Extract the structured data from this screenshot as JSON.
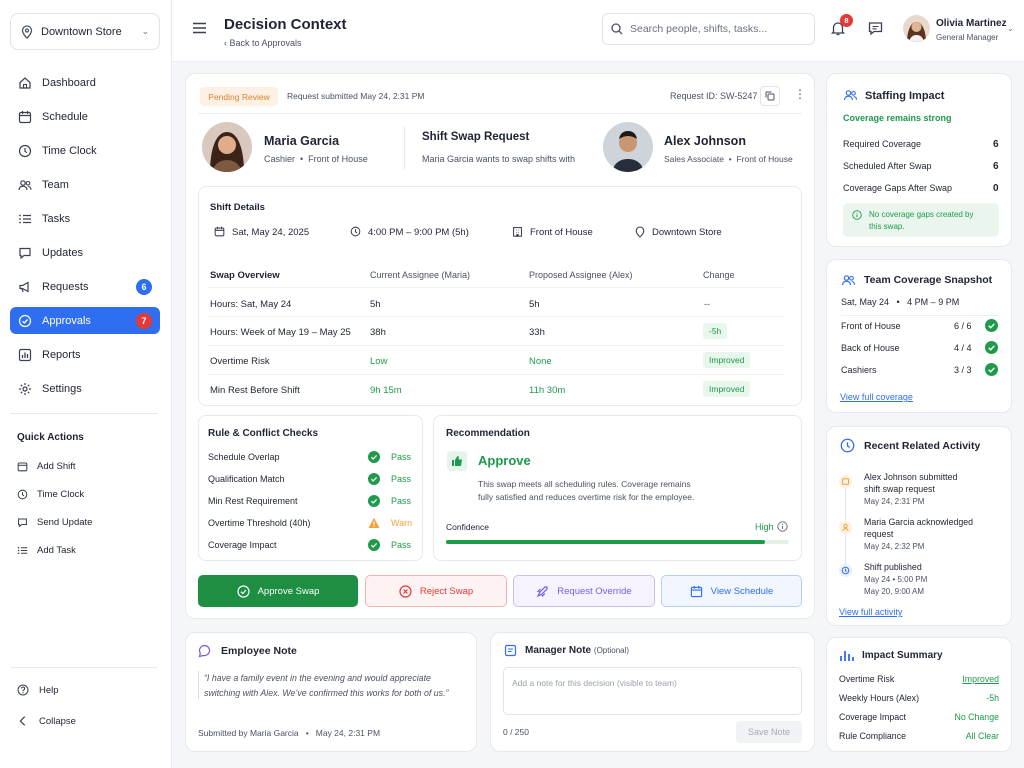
{
  "sidebar": {
    "store": "Downtown Store",
    "items": [
      {
        "label": "Dashboard",
        "icon": "home-icon"
      },
      {
        "label": "Schedule",
        "icon": "calendar-icon"
      },
      {
        "label": "Time Clock",
        "icon": "clock-icon"
      },
      {
        "label": "Team",
        "icon": "users-icon"
      },
      {
        "label": "Tasks",
        "icon": "list-icon"
      },
      {
        "label": "Updates",
        "icon": "message-icon"
      },
      {
        "label": "Requests",
        "icon": "megaphone-icon",
        "badge": "6"
      },
      {
        "label": "Approvals",
        "icon": "check-badge-icon",
        "badge": "7",
        "active": true
      },
      {
        "label": "Reports",
        "icon": "chart-icon"
      },
      {
        "label": "Settings",
        "icon": "gear-icon"
      }
    ],
    "quick_actions_title": "Quick Actions",
    "quick_actions": [
      "Add Shift",
      "Time Clock",
      "Send Update",
      "Add Task"
    ],
    "help": "Help",
    "collapse": "Collapse"
  },
  "header": {
    "title": "Decision Context",
    "back": "Back to Approvals",
    "search_placeholder": "Search people, shifts, tasks...",
    "notif_count": "8",
    "user_name": "Olivia Martinez",
    "user_role": "General Manager"
  },
  "request": {
    "status": "Pending Review",
    "submitted": "Request submitted May 24, 2:31 PM",
    "id": "Request ID: SW-5247",
    "from": {
      "name": "Maria Garcia",
      "role": "Cashier",
      "dept": "Front of House"
    },
    "type": "Shift Swap Request",
    "desc": "Maria Garcia wants to swap shifts with",
    "to": {
      "name": "Alex Johnson",
      "role": "Sales Associate",
      "dept": "Front of House"
    }
  },
  "shift": {
    "title": "Shift Details",
    "date": "Sat, May 24, 2025",
    "time": "4:00 PM – 9:00 PM (5h)",
    "area": "Front of House",
    "location": "Downtown Store"
  },
  "overview": {
    "headers": [
      "Swap Overview",
      "Current Assignee (Maria)",
      "Proposed Assignee (Alex)",
      "Change"
    ],
    "rows": [
      {
        "label": "Hours: Sat, May 24",
        "current": "5h",
        "proposed": "5h",
        "change": "--",
        "tag": false
      },
      {
        "label": "Hours: Week of May 19 – May 25",
        "current": "38h",
        "proposed": "33h",
        "change": "-5h",
        "tag": true
      },
      {
        "label": "Overtime Risk",
        "current": "Low",
        "proposed": "None",
        "change": "Improved",
        "tag": true,
        "green": true
      },
      {
        "label": "Min Rest Before Shift",
        "current": "9h 15m",
        "proposed": "11h 30m",
        "change": "Improved",
        "tag": true,
        "green": true
      }
    ]
  },
  "checks": {
    "title": "Rule & Conflict Checks",
    "items": [
      {
        "label": "Schedule Overlap",
        "status": "Pass"
      },
      {
        "label": "Qualification Match",
        "status": "Pass"
      },
      {
        "label": "Min Rest Requirement",
        "status": "Pass"
      },
      {
        "label": "Overtime Threshold (40h)",
        "status": "Warn"
      },
      {
        "label": "Coverage Impact",
        "status": "Pass"
      }
    ]
  },
  "recommendation": {
    "title": "Recommendation",
    "verdict": "Approve",
    "text1": "This swap meets all scheduling rules. Coverage remains",
    "text2": "fully satisfied and reduces overtime risk for the employee.",
    "confidence_label": "Confidence",
    "confidence_value": "High",
    "confidence_fraction": 0.93
  },
  "actions": {
    "approve": "Approve Swap",
    "reject": "Reject Swap",
    "override": "Request Override",
    "schedule": "View Schedule"
  },
  "employee_note": {
    "title": "Employee Note",
    "text1": "“I have a family event in the evening and would appreciate",
    "text2": "switching with Alex. We’ve confirmed this works for both of us.”",
    "footer": "Submitted by Maria Garcia   •   May 24, 2:31 PM"
  },
  "manager_note": {
    "title": "Manager Note",
    "optional": "(Optional)",
    "placeholder": "Add a note for this decision (visible to team)",
    "count": "0 / 250",
    "save": "Save Note"
  },
  "staffing": {
    "title": "Staffing Impact",
    "status": "Coverage remains strong",
    "rows": [
      {
        "label": "Required Coverage",
        "value": "6"
      },
      {
        "label": "Scheduled After Swap",
        "value": "6"
      },
      {
        "label": "Coverage Gaps After Swap",
        "value": "0"
      }
    ],
    "note1": "No coverage gaps created by",
    "note2": "this swap."
  },
  "snapshot": {
    "title": "Team Coverage Snapshot",
    "subtitle": "Sat, May 24   •   4 PM – 9 PM",
    "rows": [
      {
        "label": "Front of House",
        "value": "6 / 6"
      },
      {
        "label": "Back of House",
        "value": "4 / 4"
      },
      {
        "label": "Cashiers",
        "value": "3 / 3"
      }
    ],
    "link": "View full coverage"
  },
  "activity": {
    "title": "Recent Related Activity",
    "items": [
      {
        "line1": "Alex Johnson submitted",
        "line2": "shift swap request",
        "time": "May 24, 2:31 PM",
        "color": "#f0a23b"
      },
      {
        "line1": "Maria Garcia acknowledged",
        "line2": "request",
        "time": "May 24, 2:32 PM",
        "color": "#f0a23b"
      },
      {
        "line1": "Shift published",
        "line2": "",
        "time": "May 24  •  5:00 PM",
        "time2": "May 20, 9:00 AM",
        "color": "#2f6ef0"
      }
    ],
    "link": "View full activity"
  },
  "impact": {
    "title": "Impact Summary",
    "rows": [
      {
        "label": "Overtime Risk",
        "value": "Improved",
        "underline": true
      },
      {
        "label": "Weekly Hours (Alex)",
        "value": "-5h"
      },
      {
        "label": "Coverage Impact",
        "value": "No Change"
      },
      {
        "label": "Rule Compliance",
        "value": "All Clear"
      }
    ]
  },
  "colors": {
    "accent": "#2f6ef0",
    "success": "#1e9a4a",
    "warn": "#f0a23b",
    "danger": "#e53935",
    "override": "#7b5be0"
  }
}
